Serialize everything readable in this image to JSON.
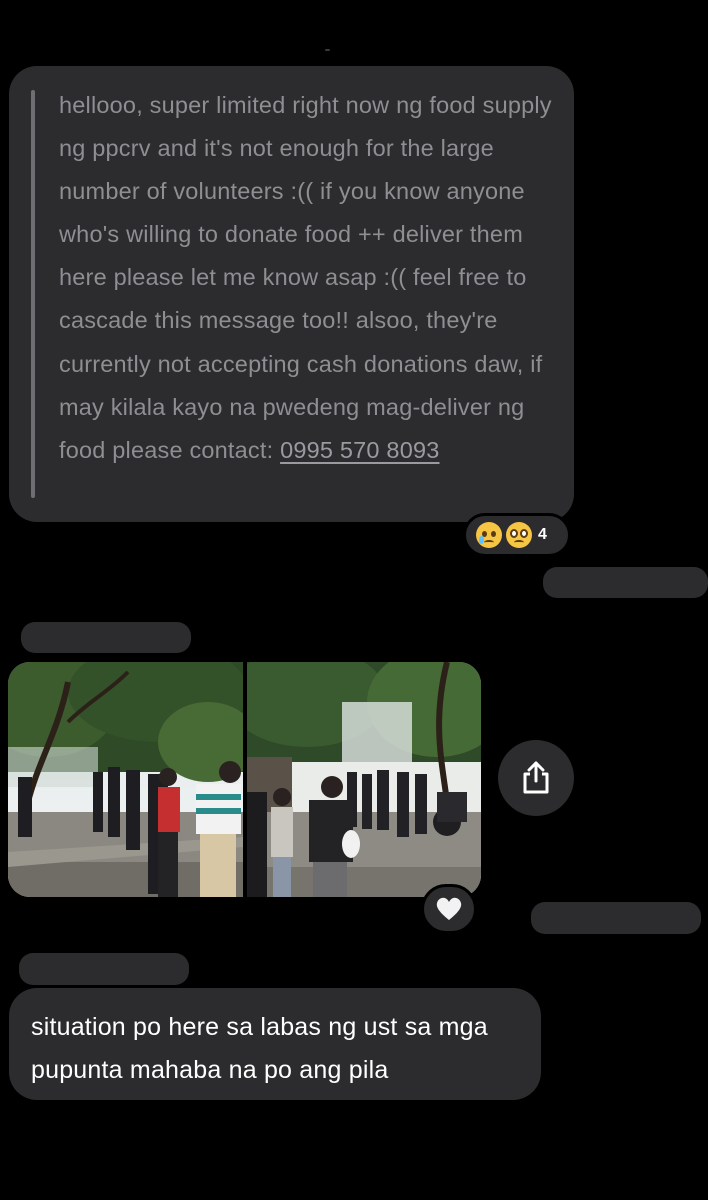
{
  "quoted_message": {
    "text": "hellooo, super limited right now ng food supply ng ppcrv and it's not enough for the large number of volunteers :(( if you know anyone who's willing to donate food ++ deliver them here please let me know asap :(( feel free to cascade this message too!!  alsoo, they're currently not accepting cash donations daw, if may kilala kayo na pwedeng mag-deliver ng food please contact: ",
    "phone": "0995 570 8093",
    "reactions": {
      "emojis": [
        "crying-face",
        "pleading-face"
      ],
      "count": "4"
    }
  },
  "photo_message": {
    "photos": [
      "street-crowd-photo-1",
      "street-crowd-photo-2"
    ],
    "share_icon": "share-icon",
    "reaction_icon": "heart-icon"
  },
  "text_message": {
    "text": "situation po here sa labas ng ust sa mga pupunta mahaba na po ang pila"
  },
  "colors": {
    "background": "#000000",
    "bubble": "#2c2c2e",
    "quoted_text": "#8e8e93",
    "message_text": "#ffffff"
  }
}
